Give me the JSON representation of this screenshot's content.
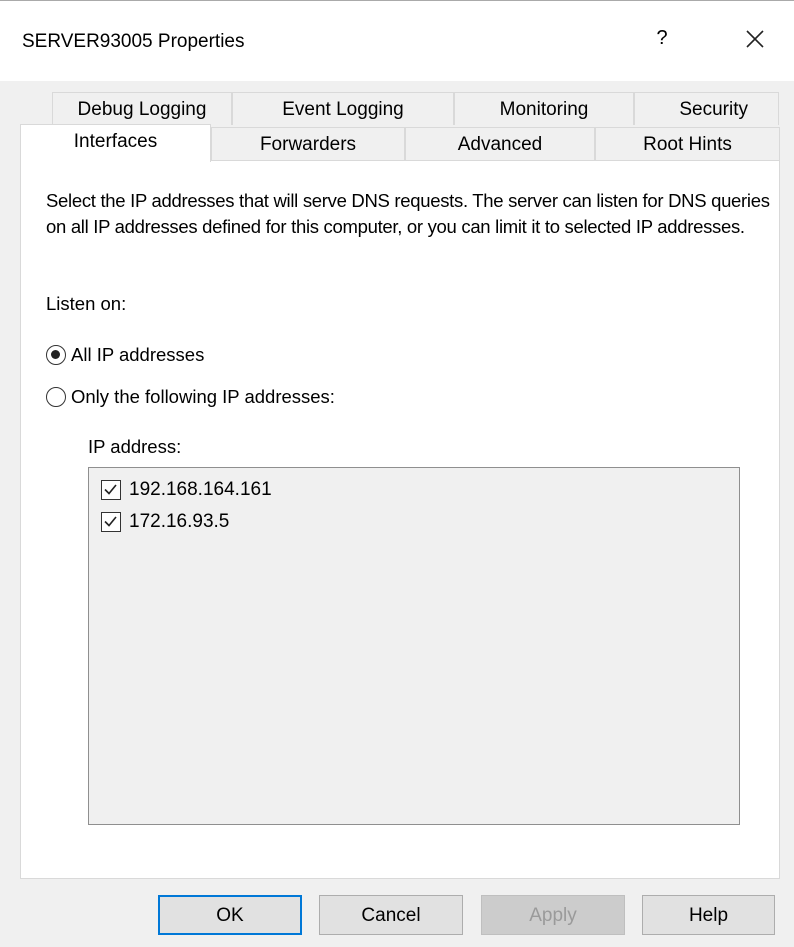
{
  "window": {
    "title": "SERVER93005 Properties",
    "help_glyph": "?",
    "close_icon": "close-icon"
  },
  "tabs": {
    "row1": [
      {
        "label": "Debug Logging"
      },
      {
        "label": "Event Logging"
      },
      {
        "label": "Monitoring"
      },
      {
        "label": "Security"
      }
    ],
    "row2": [
      {
        "label": "Interfaces",
        "active": true
      },
      {
        "label": "Forwarders"
      },
      {
        "label": "Advanced"
      },
      {
        "label": "Root Hints"
      }
    ]
  },
  "interfaces": {
    "description": "Select the IP addresses that will serve DNS requests. The server can listen for DNS queries on all IP addresses defined for this computer, or you can limit it to selected IP addresses.",
    "listen_on_label": "Listen on:",
    "radio_all": {
      "label": "All IP addresses",
      "checked": true
    },
    "radio_only": {
      "label": "Only the following IP addresses:",
      "checked": false
    },
    "ip_address_label": "IP address:",
    "ip_addresses": [
      {
        "address": "192.168.164.161",
        "checked": true
      },
      {
        "address": "172.16.93.5",
        "checked": true
      }
    ]
  },
  "buttons": {
    "ok": "OK",
    "cancel": "Cancel",
    "apply": "Apply",
    "help": "Help"
  },
  "colors": {
    "accent": "#0078d7",
    "dialog_bg": "#f0f0f0"
  }
}
